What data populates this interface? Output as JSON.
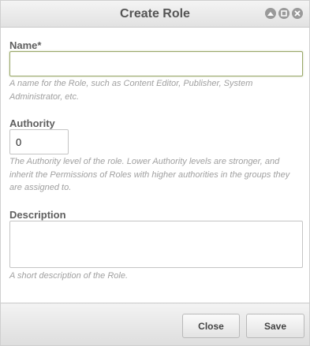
{
  "dialog": {
    "title": "Create Role",
    "controls": [
      "collapse-icon",
      "maximize-icon",
      "close-icon"
    ]
  },
  "form": {
    "name": {
      "label": "Name*",
      "value": "",
      "help": "A name for the Role, such as Content Editor, Publisher, System Administrator, etc."
    },
    "authority": {
      "label": "Authority",
      "value": "0",
      "help": "The Authority level of the role. Lower Authority levels are stronger, and inherit the Permissions of Roles with higher authorities in the groups they are assigned to."
    },
    "description": {
      "label": "Description",
      "value": "",
      "help": "A short description of the Role."
    }
  },
  "footer": {
    "close_label": "Close",
    "save_label": "Save"
  },
  "colors": {
    "focus_border": "#9aa86a",
    "title_text": "#555555",
    "help_text": "#a0a0a0"
  }
}
